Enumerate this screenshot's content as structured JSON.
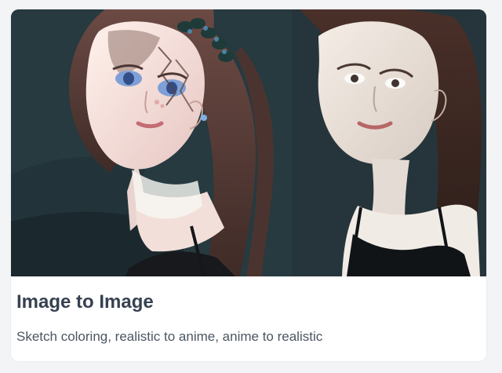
{
  "card": {
    "title": "Image to Image",
    "description": "Sketch coloring, realistic to anime, anime to realistic"
  },
  "images": [
    {
      "kind": "anime-style portrait",
      "side": "left"
    },
    {
      "kind": "realistic portrait",
      "side": "right"
    }
  ],
  "colors": {
    "page_background": "#f3f4f6",
    "card_background": "#ffffff",
    "title_text": "#374151",
    "description_text": "#4b5563",
    "image_background": "#243439"
  }
}
